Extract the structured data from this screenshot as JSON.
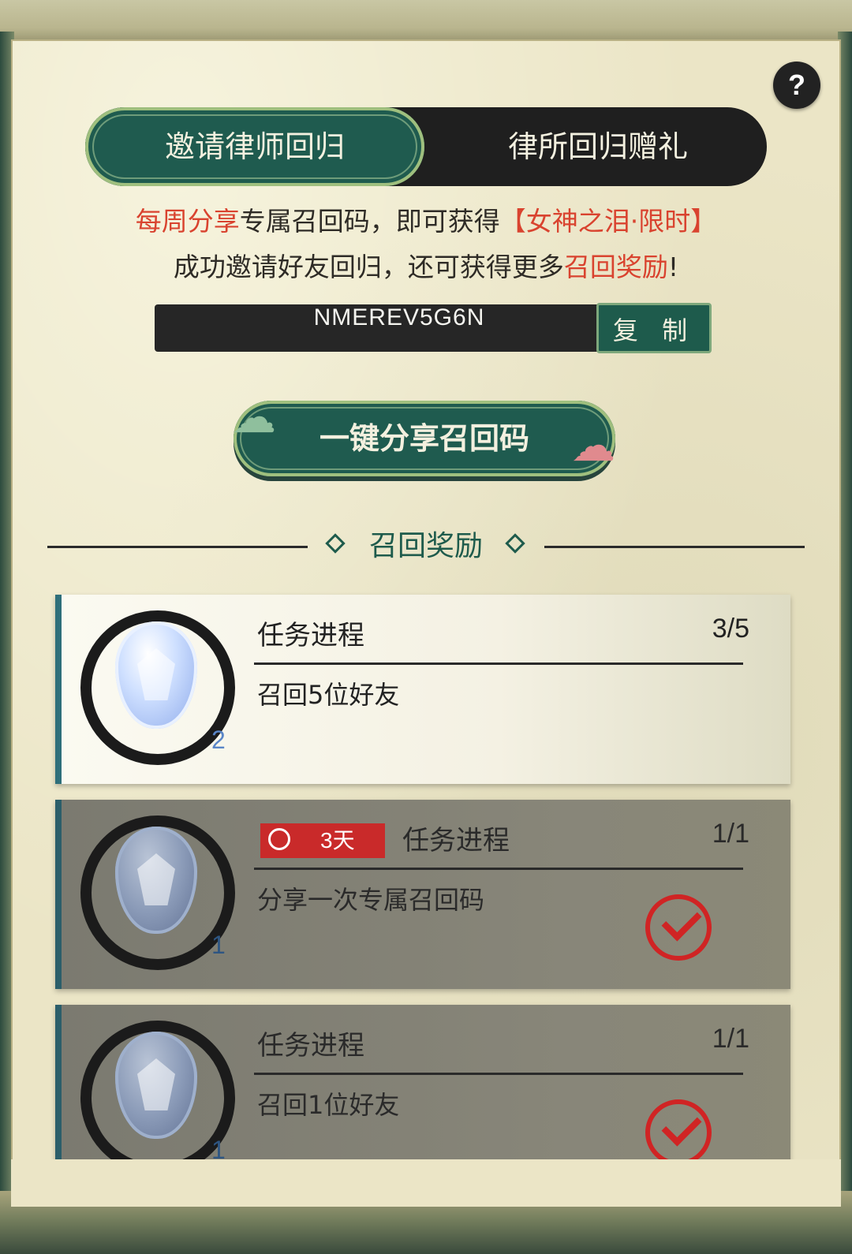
{
  "tabs": [
    {
      "label": "邀请律师回归",
      "active": true
    },
    {
      "label": "律所回归赠礼",
      "active": false
    }
  ],
  "help_label": "?",
  "info": {
    "line1_highlight1": "每周分享",
    "line1_middle": "专属召回码，即可获得",
    "line1_highlight2": "【女神之泪·限时】",
    "line2_prefix": "成功邀请好友回归，还可获得更多",
    "line2_highlight": "召回奖励",
    "line2_suffix": "!"
  },
  "recall_code": "NMEREV5G6N",
  "copy_label": "复 制",
  "share_button_label": "一键分享召回码",
  "section_title": "召回奖励",
  "tasks": [
    {
      "label": "任务进程",
      "progress": "3/5",
      "desc": "召回5位好友",
      "reward_count": "2",
      "completed": false
    },
    {
      "label": "任务进程",
      "progress": "1/1",
      "desc": "分享一次专属召回码",
      "reward_count": "1",
      "completed": true,
      "timer": "3天"
    },
    {
      "label": "任务进程",
      "progress": "1/1",
      "desc": "召回1位好友",
      "reward_count": "1",
      "completed": true
    }
  ],
  "colors": {
    "accent_green": "#1f5b4f",
    "highlight_red": "#d9432f",
    "check_red": "#d02424"
  }
}
